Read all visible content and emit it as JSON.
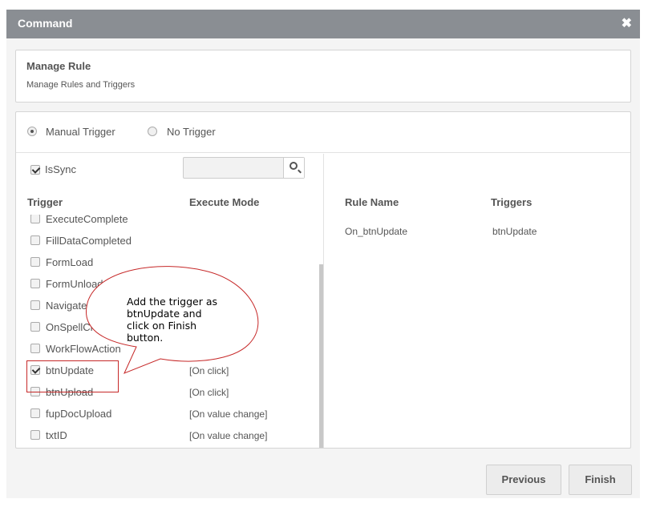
{
  "dialog": {
    "title": "Command",
    "close_symbol": "✖"
  },
  "rule": {
    "heading": "Manage Rule",
    "subheading": "Manage Rules and Triggers"
  },
  "trigger_type": {
    "options": [
      {
        "label": "Manual Trigger",
        "selected": true
      },
      {
        "label": "No Trigger",
        "selected": false
      }
    ]
  },
  "issync": {
    "label": "IsSync",
    "checked": true
  },
  "search": {
    "value": "",
    "placeholder": "",
    "icon": "search-icon"
  },
  "columns": {
    "trigger": "Trigger",
    "execute_mode": "Execute Mode",
    "rule_name": "Rule Name",
    "triggers": "Triggers"
  },
  "trigger_list": [
    {
      "name": "ExecuteComplete",
      "mode": "",
      "checked": false
    },
    {
      "name": "FillDataCompleted",
      "mode": "",
      "checked": false
    },
    {
      "name": "FormLoad",
      "mode": "",
      "checked": false
    },
    {
      "name": "FormUnload",
      "mode": "",
      "checked": false
    },
    {
      "name": "NavigateAway",
      "mode": "",
      "checked": false
    },
    {
      "name": "OnSpellCheck",
      "mode": "",
      "checked": false
    },
    {
      "name": "WorkFlowAction",
      "mode": "",
      "checked": false
    },
    {
      "name": "btnUpdate",
      "mode": "[On click]",
      "checked": true
    },
    {
      "name": "btnUpload",
      "mode": "[On click]",
      "checked": false
    },
    {
      "name": "fupDocUpload",
      "mode": "[On value change]",
      "checked": false
    },
    {
      "name": "txtID",
      "mode": "[On value change]",
      "checked": false
    }
  ],
  "rules_table": [
    {
      "rule_name": "On_btnUpdate",
      "triggers": "btnUpdate"
    }
  ],
  "callout": {
    "lines": [
      "Add the trigger as",
      "btnUpdate and",
      "click on Finish",
      "button."
    ]
  },
  "buttons": {
    "previous": "Previous",
    "finish": "Finish"
  }
}
